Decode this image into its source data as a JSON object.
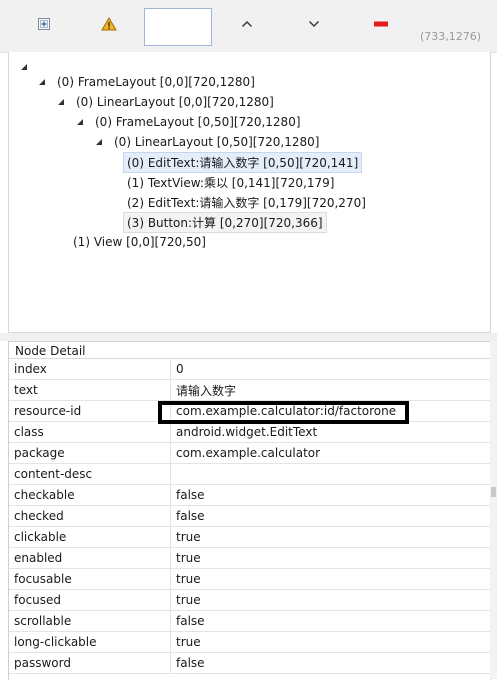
{
  "toolbar": {
    "search_value": "",
    "coords": "(733,1276)",
    "warning_color": "#e8a317",
    "minus_color": "#e11d1d"
  },
  "tree": {
    "nodes": [
      {
        "label": "(0) FrameLayout [0,0][720,1280]"
      },
      {
        "label": "(0) LinearLayout [0,0][720,1280]"
      },
      {
        "label": "(0) FrameLayout [0,50][720,1280]"
      },
      {
        "label": "(0) LinearLayout [0,50][720,1280]"
      },
      {
        "label": "(0) EditText:请输入数字 [0,50][720,141]"
      },
      {
        "label": "(1) TextView:乘以 [0,141][720,179]"
      },
      {
        "label": "(2) EditText:请输入数字 [0,179][720,270]"
      },
      {
        "label": "(3) Button:计算 [0,270][720,366]"
      },
      {
        "label": "(1) View [0,0][720,50]"
      }
    ]
  },
  "detail": {
    "title": "Node Detail",
    "rows": [
      {
        "key": "index",
        "value": "0"
      },
      {
        "key": "text",
        "value": "请输入数字"
      },
      {
        "key": "resource-id",
        "value": "com.example.calculator:id/factorone"
      },
      {
        "key": "class",
        "value": "android.widget.EditText"
      },
      {
        "key": "package",
        "value": "com.example.calculator"
      },
      {
        "key": "content-desc",
        "value": ""
      },
      {
        "key": "checkable",
        "value": "false"
      },
      {
        "key": "checked",
        "value": "false"
      },
      {
        "key": "clickable",
        "value": "true"
      },
      {
        "key": "enabled",
        "value": "true"
      },
      {
        "key": "focusable",
        "value": "true"
      },
      {
        "key": "focused",
        "value": "true"
      },
      {
        "key": "scrollable",
        "value": "false"
      },
      {
        "key": "long-clickable",
        "value": "true"
      },
      {
        "key": "password",
        "value": "false"
      }
    ]
  }
}
